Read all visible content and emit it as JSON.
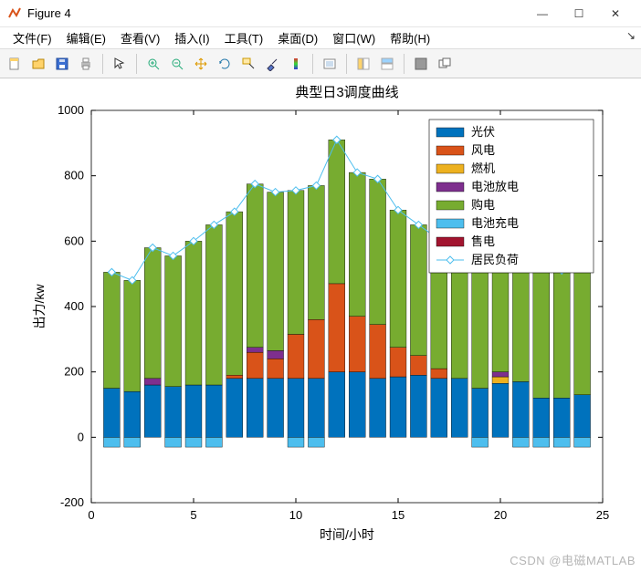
{
  "window": {
    "title": "Figure 4",
    "min": "—",
    "max": "☐",
    "close": "✕"
  },
  "menubar": {
    "items": [
      "文件(F)",
      "编辑(E)",
      "查看(V)",
      "插入(I)",
      "工具(T)",
      "桌面(D)",
      "窗口(W)",
      "帮助(H)"
    ],
    "expand": "↘"
  },
  "toolbar": {
    "groups": [
      [
        "new-file-icon",
        "open-icon",
        "save-icon",
        "print-icon"
      ],
      [
        "pointer-icon"
      ],
      [
        "zoom-in-icon",
        "zoom-out-icon",
        "pan-icon",
        "rotate-icon",
        "data-cursor-icon",
        "brush-icon",
        "colorbar-icon"
      ],
      [
        "link-icon"
      ],
      [
        "layout1-icon",
        "layout2-icon"
      ],
      [
        "dock-icon",
        "undock-icon"
      ]
    ]
  },
  "chart_data": {
    "type": "bar",
    "title": "典型日3调度曲线",
    "xlabel": "时间/小时",
    "ylabel": "出力/kw",
    "xlim": [
      0,
      25
    ],
    "ylim": [
      -200,
      1000
    ],
    "yticks": [
      -200,
      0,
      200,
      400,
      600,
      800,
      1000
    ],
    "xticks": [
      0,
      5,
      10,
      15,
      20,
      25
    ],
    "categories": [
      1,
      2,
      3,
      4,
      5,
      6,
      7,
      8,
      9,
      10,
      11,
      12,
      13,
      14,
      15,
      16,
      17,
      18,
      19,
      20,
      21,
      22,
      23,
      24
    ],
    "series": [
      {
        "name": "光伏",
        "color": "#0072BD",
        "values": [
          150,
          140,
          160,
          155,
          160,
          160,
          180,
          180,
          180,
          180,
          180,
          200,
          200,
          180,
          185,
          190,
          180,
          180,
          150,
          165,
          170,
          120,
          120,
          130
        ]
      },
      {
        "name": "风电",
        "color": "#D95319",
        "values": [
          0,
          0,
          0,
          0,
          0,
          0,
          10,
          80,
          60,
          135,
          180,
          270,
          170,
          165,
          90,
          60,
          30,
          0,
          0,
          0,
          0,
          0,
          0,
          0
        ]
      },
      {
        "name": "燃机",
        "color": "#EDB120",
        "values": [
          0,
          0,
          0,
          0,
          0,
          0,
          0,
          0,
          0,
          0,
          0,
          0,
          0,
          0,
          0,
          0,
          0,
          0,
          0,
          20,
          0,
          0,
          0,
          0
        ]
      },
      {
        "name": "电池放电",
        "color": "#7E2F8E",
        "values": [
          0,
          0,
          20,
          0,
          0,
          0,
          0,
          15,
          25,
          0,
          0,
          0,
          0,
          0,
          0,
          0,
          0,
          0,
          0,
          15,
          0,
          0,
          0,
          0
        ]
      },
      {
        "name": "购电",
        "color": "#77AC30",
        "values": [
          355,
          340,
          400,
          400,
          440,
          490,
          500,
          500,
          485,
          440,
          410,
          440,
          440,
          445,
          420,
          400,
          395,
          460,
          460,
          460,
          420,
          410,
          390,
          410
        ]
      },
      {
        "name": "电池充电",
        "color": "#4DBEEE",
        "values": [
          -30,
          -30,
          0,
          -30,
          -30,
          -30,
          0,
          0,
          0,
          -30,
          -30,
          0,
          0,
          0,
          0,
          0,
          0,
          0,
          -30,
          0,
          -30,
          -30,
          -30,
          -30
        ]
      },
      {
        "name": "售电",
        "color": "#A2142F",
        "values": [
          0,
          0,
          0,
          0,
          0,
          0,
          0,
          0,
          0,
          0,
          0,
          0,
          0,
          0,
          0,
          0,
          0,
          0,
          0,
          0,
          0,
          0,
          0,
          0
        ]
      }
    ],
    "line_series": {
      "name": "居民负荷",
      "color": "#4DBEEE",
      "marker": "diamond",
      "values": [
        505,
        480,
        580,
        555,
        600,
        650,
        690,
        775,
        750,
        755,
        770,
        910,
        810,
        790,
        695,
        650,
        605,
        640,
        640,
        660,
        560,
        530,
        510,
        540
      ]
    },
    "legend": [
      "光伏",
      "风电",
      "燃机",
      "电池放电",
      "购电",
      "电池充电",
      "售电",
      "居民负荷"
    ]
  },
  "watermark": "CSDN @电磁MATLAB"
}
